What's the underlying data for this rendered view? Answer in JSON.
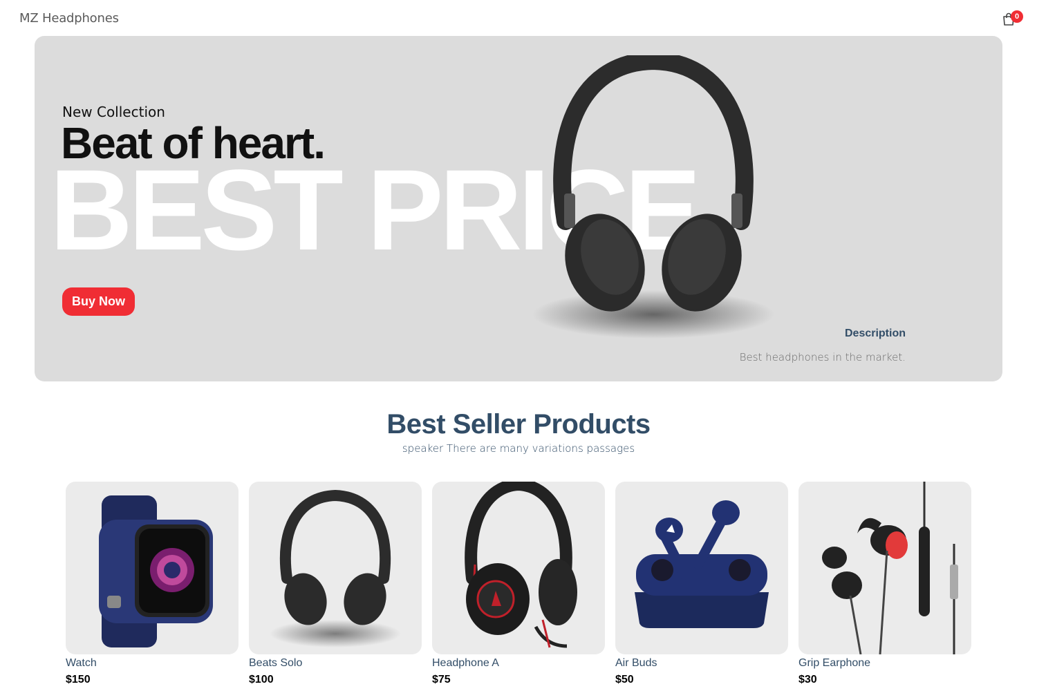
{
  "navbar": {
    "logo": "MZ Headphones",
    "cart_count": "0"
  },
  "hero": {
    "small_text": "New Collection",
    "mid_text": "Beat of heart.",
    "large_text": "BEST PRICE",
    "button_label": "Buy Now",
    "desc_title": "Description",
    "desc_text": "Best headphones in the market."
  },
  "section": {
    "title": "Best Seller Products",
    "subtitle": "speaker There are many variations passages"
  },
  "products": [
    {
      "name": "Watch",
      "price": "$150",
      "icon": "smartwatch-image"
    },
    {
      "name": "Beats Solo",
      "price": "$100",
      "icon": "headphones-image"
    },
    {
      "name": "Headphone A",
      "price": "$75",
      "icon": "gaming-headset-image"
    },
    {
      "name": "Air Buds",
      "price": "$50",
      "icon": "earbuds-image"
    },
    {
      "name": "Grip Earphone",
      "price": "$30",
      "icon": "wired-earphones-image"
    }
  ],
  "colors": {
    "accent": "#f02d34",
    "heading": "#324d67",
    "hero_bg": "#dcdcdc",
    "card_bg": "#ebebeb"
  }
}
